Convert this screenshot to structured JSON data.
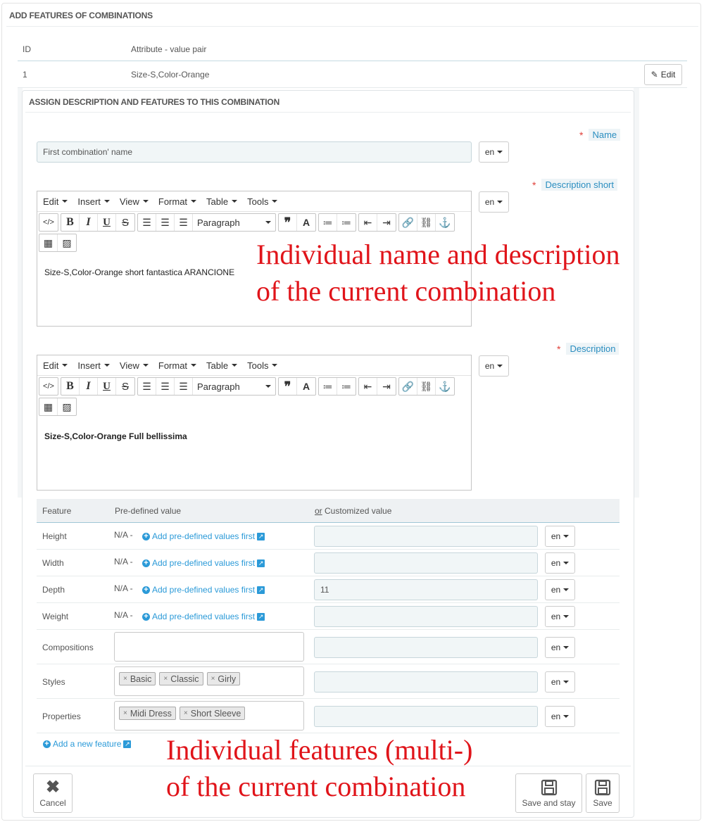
{
  "panel": {
    "title": "ADD FEATURES OF COMBINATIONS"
  },
  "combinations_table": {
    "headers": [
      "ID",
      "Attribute - value pair"
    ],
    "rows": [
      {
        "id": "1",
        "pair": "Size-S,Color-Orange"
      }
    ],
    "edit_label": "Edit"
  },
  "assign_panel": {
    "title": "ASSIGN DESCRIPTION AND FEATURES TO THIS COMBINATION",
    "name_label": "Name",
    "name_value": "First combination' name",
    "lang": "en",
    "desc_short_label": "Description short",
    "desc_short_content": "Size-S,Color-Orange short fantastica ARANCIONE",
    "desc_label": "Description",
    "desc_content": "Size-S,Color-Orange Full bellissima"
  },
  "editor": {
    "menus": [
      "Edit",
      "Insert",
      "View",
      "Format",
      "Table",
      "Tools"
    ],
    "format_select": "Paragraph"
  },
  "features": {
    "headers": {
      "feature": "Feature",
      "predefined": "Pre-defined value",
      "custom_or": "or",
      "custom": "Customized value"
    },
    "na_text": "N/A -",
    "add_predefined_link": "Add pre-defined values first",
    "rows": [
      {
        "name": "Height",
        "custom": ""
      },
      {
        "name": "Width",
        "custom": ""
      },
      {
        "name": "Depth",
        "custom": "11"
      },
      {
        "name": "Weight",
        "custom": ""
      },
      {
        "name": "Compositions",
        "custom": "",
        "tags": []
      },
      {
        "name": "Styles",
        "custom": "",
        "tags": [
          "Basic",
          "Classic",
          "Girly"
        ]
      },
      {
        "name": "Properties",
        "custom": "",
        "tags": [
          "Midi Dress",
          "Short Sleeve"
        ]
      }
    ],
    "add_feature_link": "Add a new feature"
  },
  "annotations": {
    "top_line1": "Individual name and description",
    "top_line2": "of the current combination",
    "bottom_line1": "Individual features (multi-)",
    "bottom_line2": "of the current combination",
    "color": "#e0141a"
  },
  "footer": {
    "cancel": "Cancel",
    "save_and_stay": "Save and stay",
    "save": "Save"
  }
}
